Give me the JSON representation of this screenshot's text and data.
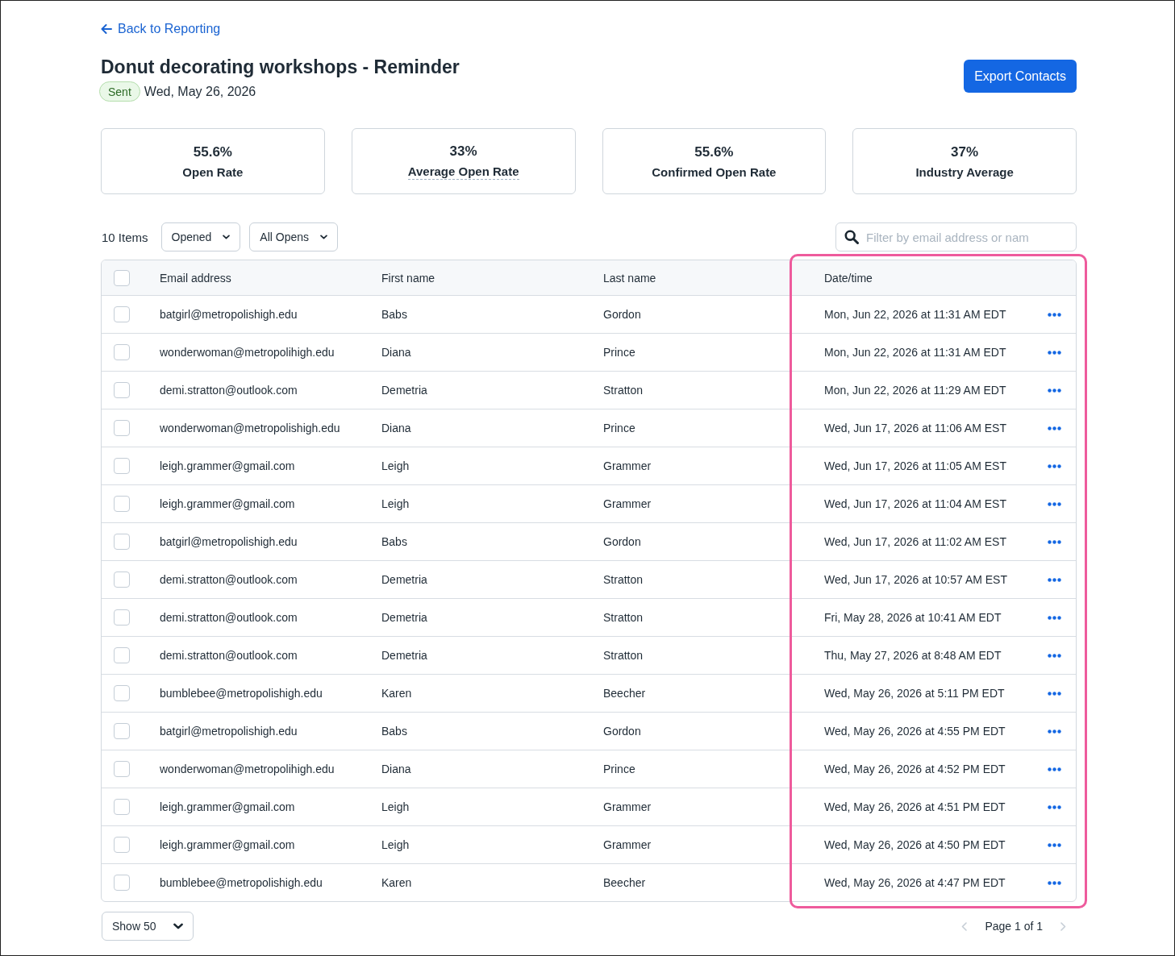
{
  "back_link": {
    "label": "Back to Reporting"
  },
  "title": "Donut decorating workshops - Reminder",
  "status": {
    "label": "Sent",
    "kind": "success"
  },
  "sent_date": "Wed, May 26, 2026",
  "export_button": {
    "label": "Export Contacts"
  },
  "stats": [
    {
      "value": "55.6%",
      "label": "Open Rate",
      "has_tooltip": false
    },
    {
      "value": "33%",
      "label": "Average Open Rate",
      "has_tooltip": true
    },
    {
      "value": "55.6%",
      "label": "Confirmed Open Rate",
      "has_tooltip": false
    },
    {
      "value": "37%",
      "label": "Industry Average",
      "has_tooltip": false
    }
  ],
  "toolbar": {
    "count": "10 Items",
    "filters": [
      {
        "label": "Opened"
      },
      {
        "label": "All Opens"
      }
    ],
    "search": {
      "placeholder": "Filter by email address or nam"
    }
  },
  "table": {
    "all_checked": false,
    "columns": [
      {
        "label": "Email address",
        "highlighted": false
      },
      {
        "label": "First name",
        "highlighted": false
      },
      {
        "label": "Last name",
        "highlighted": false
      },
      {
        "label": "Date/time",
        "highlighted": true
      }
    ],
    "rows": [
      {
        "checked": false,
        "email": "batgirl@metropolishigh.edu",
        "first_name": "Babs",
        "last_name": "Gordon",
        "date_time": "Mon, Jun 22, 2026 at 11:31 AM EDT"
      },
      {
        "checked": false,
        "email": "wonderwoman@metropolihigh.edu",
        "first_name": "Diana",
        "last_name": "Prince",
        "date_time": "Mon, Jun 22, 2026 at 11:31 AM EDT"
      },
      {
        "checked": false,
        "email": "demi.stratton@outlook.com",
        "first_name": "Demetria",
        "last_name": "Stratton",
        "date_time": "Mon, Jun 22, 2026 at 11:29 AM EDT"
      },
      {
        "checked": false,
        "email": "wonderwoman@metropolishigh.edu",
        "first_name": "Diana",
        "last_name": "Prince",
        "date_time": "Wed, Jun 17, 2026 at 11:06 AM EST"
      },
      {
        "checked": false,
        "email": "leigh.grammer@gmail.com",
        "first_name": "Leigh",
        "last_name": "Grammer",
        "date_time": "Wed, Jun 17, 2026 at 11:05 AM EST"
      },
      {
        "checked": false,
        "email": "leigh.grammer@gmail.com",
        "first_name": "Leigh",
        "last_name": "Grammer",
        "date_time": "Wed, Jun 17, 2026 at 11:04 AM EST"
      },
      {
        "checked": false,
        "email": "batgirl@metropolishigh.edu",
        "first_name": "Babs",
        "last_name": "Gordon",
        "date_time": "Wed, Jun 17, 2026 at 11:02 AM EST"
      },
      {
        "checked": false,
        "email": "demi.stratton@outlook.com",
        "first_name": "Demetria",
        "last_name": "Stratton",
        "date_time": "Wed, Jun 17, 2026 at 10:57 AM EST"
      },
      {
        "checked": false,
        "email": "demi.stratton@outlook.com",
        "first_name": "Demetria",
        "last_name": "Stratton",
        "date_time": "Fri, May 28, 2026 at 10:41 AM EDT"
      },
      {
        "checked": false,
        "email": "demi.stratton@outlook.com",
        "first_name": "Demetria",
        "last_name": "Stratton",
        "date_time": "Thu, May 27, 2026 at 8:48 AM EDT"
      },
      {
        "checked": false,
        "email": "bumblebee@metropolishigh.edu",
        "first_name": "Karen",
        "last_name": "Beecher",
        "date_time": "Wed, May 26, 2026 at 5:11 PM EDT"
      },
      {
        "checked": false,
        "email": "batgirl@metropolishigh.edu",
        "first_name": "Babs",
        "last_name": "Gordon",
        "date_time": "Wed, May 26, 2026 at 4:55 PM EDT"
      },
      {
        "checked": false,
        "email": "wonderwoman@metropolihigh.edu",
        "first_name": "Diana",
        "last_name": "Prince",
        "date_time": "Wed, May 26, 2026 at 4:52 PM EDT"
      },
      {
        "checked": false,
        "email": "leigh.grammer@gmail.com",
        "first_name": "Leigh",
        "last_name": "Grammer",
        "date_time": "Wed, May 26, 2026 at 4:51 PM EDT"
      },
      {
        "checked": false,
        "email": "leigh.grammer@gmail.com",
        "first_name": "Leigh",
        "last_name": "Grammer",
        "date_time": "Wed, May 26, 2026 at 4:50 PM EDT"
      },
      {
        "checked": false,
        "email": "bumblebee@metropolishigh.edu",
        "first_name": "Karen",
        "last_name": "Beecher",
        "date_time": "Wed, May 26, 2026 at 4:47 PM EDT"
      }
    ]
  },
  "footer": {
    "page_size": {
      "label": "Show 50"
    },
    "pagination": {
      "label": "Page 1 of 1",
      "prev_disabled": true,
      "next_disabled": true
    }
  }
}
